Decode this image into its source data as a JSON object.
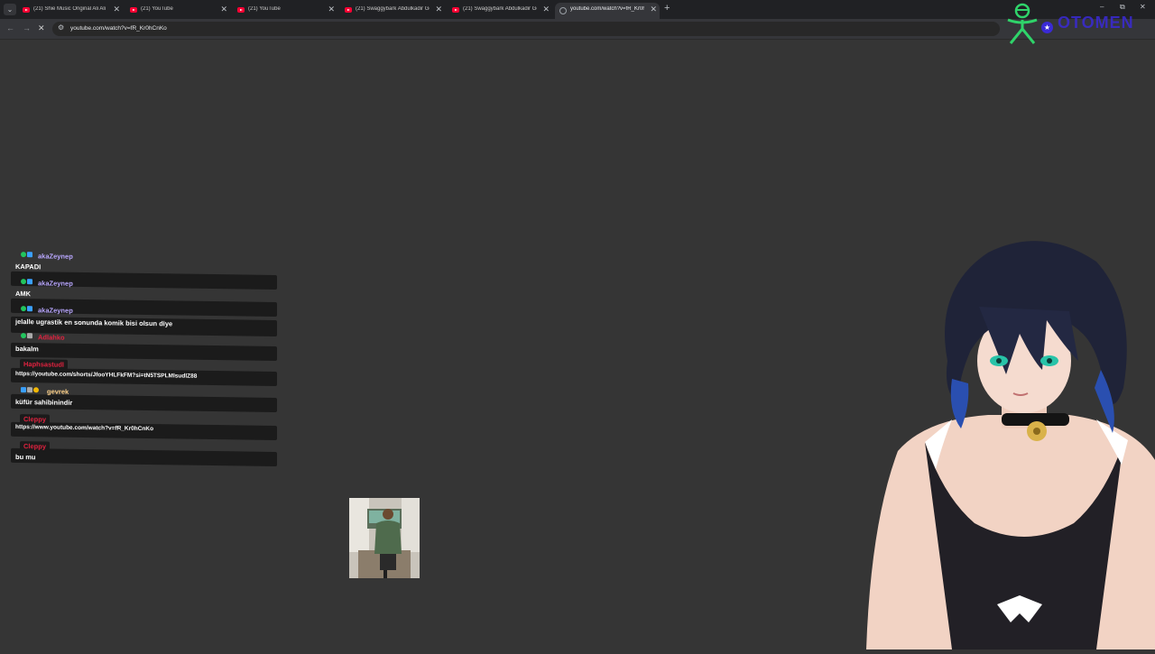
{
  "browser": {
    "tabs": [
      {
        "title": "(21) Shie Music Original Ali Ali",
        "active": false
      },
      {
        "title": "(21) YouTube",
        "active": false
      },
      {
        "title": "(21) YouTube",
        "active": false
      },
      {
        "title": "(21) Swaggybark Abdulkadir Gö",
        "active": false
      },
      {
        "title": "(21) Swaggybark Abdulkadir Gö",
        "active": false
      },
      {
        "title": "youtube.com/watch?v=fR_Kr0h",
        "active": true
      }
    ],
    "new_tab": "+",
    "window_controls": {
      "minimize": "–",
      "restore": "⧉",
      "close": "✕"
    },
    "nav": {
      "back": "←",
      "forward": "→",
      "reload": "✕"
    },
    "address_bar": {
      "url": "youtube.com/watch?v=fR_Kr0hCnKo"
    }
  },
  "overlay_logo": {
    "text": "OTOMEN",
    "icon": "person-icon"
  },
  "chat": {
    "messages": [
      {
        "user": "akaZeynep",
        "user_color": "#b9a7ff",
        "text": "KAPADI",
        "badges": [
          "check",
          "blue"
        ]
      },
      {
        "user": "akaZeynep",
        "user_color": "#b9a7ff",
        "text": "AMK",
        "badges": [
          "check",
          "blue"
        ]
      },
      {
        "user": "akaZeynep",
        "user_color": "#b9a7ff",
        "text": "jelalle ugrastik en sonunda komik bisi olsun diye",
        "badges": [
          "check",
          "blue"
        ]
      },
      {
        "user": "Adlahko",
        "user_color": "#e0223f",
        "text": "bakalm",
        "badges": [
          "check",
          "cat"
        ]
      },
      {
        "user": "Haphsastudl",
        "user_color": "#e0223f",
        "text": "https://youtube.com/shorts/JfooYHLFkFM?si=tN5TSPLMIsudlZ88",
        "badges": []
      },
      {
        "user": "gevrek",
        "user_color": "#ffd28a",
        "text": "küfür sahibinindir",
        "badges": [
          "blue",
          "cat",
          "gold"
        ]
      },
      {
        "user": "Cleppy",
        "user_color": "#e0223f",
        "text": "https://www.youtube.com/watch?v=fR_Kr0hCnKo",
        "badges": []
      },
      {
        "user": "Cleppy",
        "user_color": "#e0223f",
        "text": "bu mu",
        "badges": []
      }
    ]
  }
}
